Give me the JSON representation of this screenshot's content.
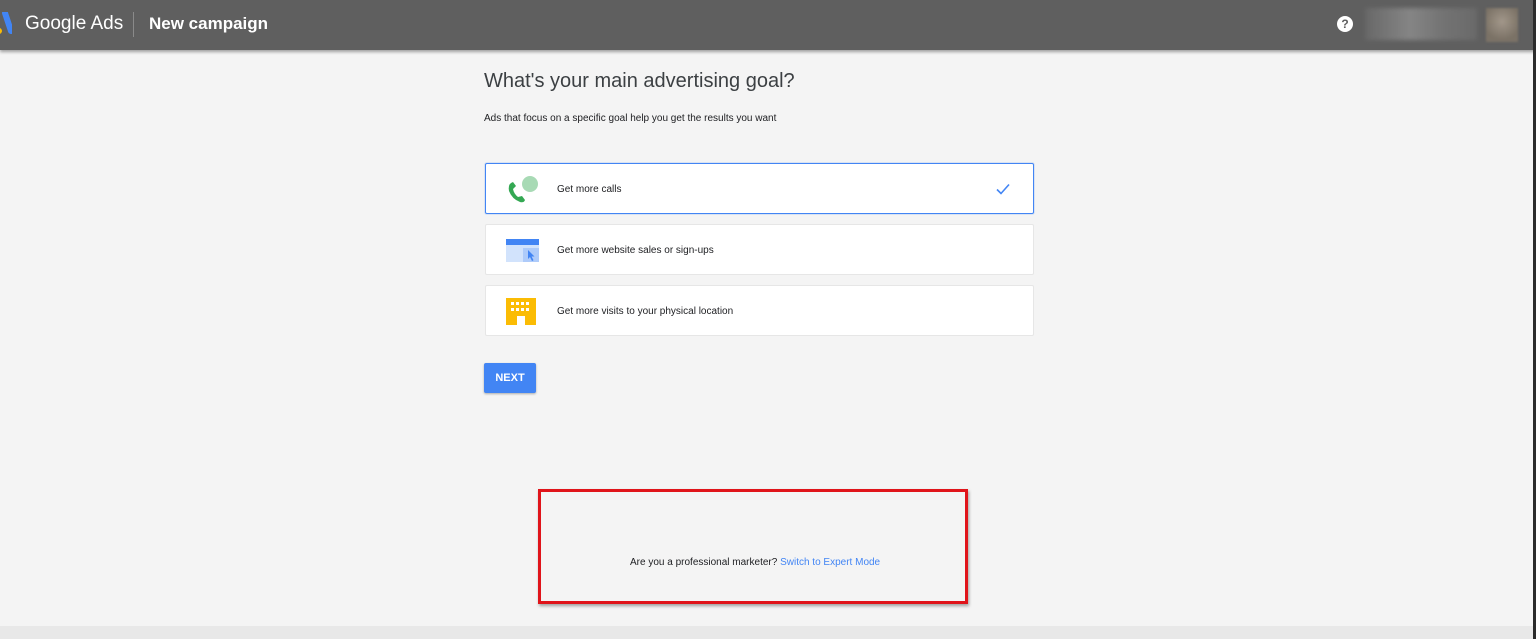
{
  "header": {
    "app_name": "Google Ads",
    "page_name": "New campaign",
    "help_label": "?"
  },
  "main": {
    "heading": "What's your main advertising goal?",
    "subheading": "Ads that focus on a specific goal help you get the results you want",
    "goals": [
      {
        "label": "Get more calls",
        "icon": "phone-call-icon",
        "selected": true
      },
      {
        "label": "Get more website sales or sign-ups",
        "icon": "website-icon",
        "selected": false
      },
      {
        "label": "Get more visits to your physical location",
        "icon": "storefront-icon",
        "selected": false
      }
    ],
    "next_label": "NEXT"
  },
  "expert": {
    "prompt": "Are you a professional marketer?",
    "link": "Switch to Expert Mode"
  },
  "colors": {
    "accent": "#4285f4",
    "header_bg": "#5f5f5f",
    "page_bg": "#f4f4f4",
    "highlight": "#e0141a"
  }
}
